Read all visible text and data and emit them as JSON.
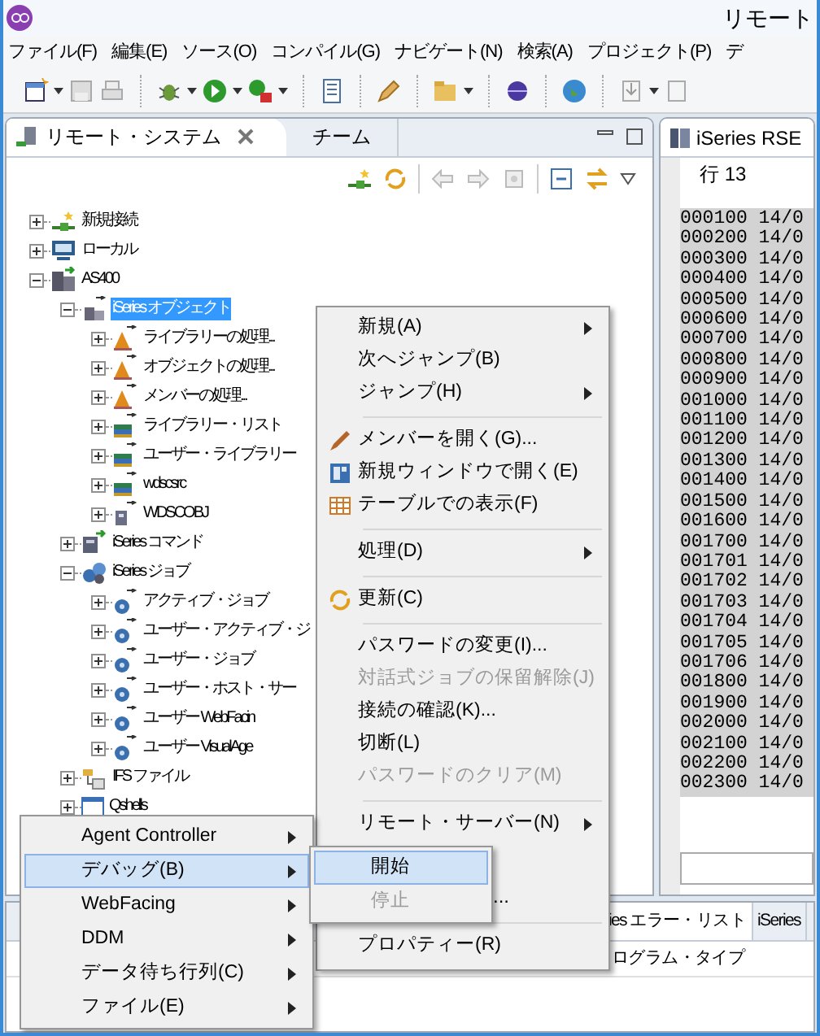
{
  "window": {
    "title": "リモート"
  },
  "menubar": [
    "ファイル(F)",
    "編集(E)",
    "ソース(O)",
    "コンパイル(G)",
    "ナビゲート(N)",
    "検索(A)",
    "プロジェクト(P)",
    "デ"
  ],
  "left_view": {
    "tabs": [
      {
        "label": "リモート・システム",
        "selected": true
      },
      {
        "label": "チーム",
        "selected": false
      }
    ],
    "tree": [
      {
        "label": "新規接続",
        "kind": "connection",
        "expanded": false,
        "selected": false
      },
      {
        "label": "ローカル",
        "kind": "local",
        "expanded": false,
        "selected": false
      },
      {
        "label": "AS400",
        "kind": "system",
        "expanded": true,
        "selected": false,
        "children": [
          {
            "label": "iSeries オブジェクト",
            "kind": "objects",
            "expanded": true,
            "selected": true,
            "children": [
              {
                "label": "ライブラリーの処理...",
                "kind": "work-filter",
                "expanded": false,
                "selected": false
              },
              {
                "label": "オブジェクトの処理...",
                "kind": "work-filter",
                "expanded": false,
                "selected": false
              },
              {
                "label": "メンバーの処理...",
                "kind": "work-filter",
                "expanded": false,
                "selected": false
              },
              {
                "label": "ライブラリー・リスト",
                "kind": "library-filter",
                "expanded": false,
                "selected": false
              },
              {
                "label": "ユーザー・ライブラリー",
                "kind": "library-filter",
                "expanded": false,
                "selected": false
              },
              {
                "label": "wdscsrc",
                "kind": "library-filter",
                "expanded": false,
                "selected": false
              },
              {
                "label": "WDSCOBJ",
                "kind": "object-filter",
                "expanded": false,
                "selected": false
              }
            ]
          },
          {
            "label": "iSeries コマンド",
            "kind": "commands",
            "expanded": false,
            "selected": false
          },
          {
            "label": "iSeries ジョブ",
            "kind": "jobs",
            "expanded": true,
            "selected": false,
            "children": [
              {
                "label": "アクティブ・ジョブ",
                "kind": "job-filter",
                "expanded": false,
                "selected": false
              },
              {
                "label": "ユーザー・アクティブ・ジ",
                "kind": "job-filter",
                "expanded": false,
                "selected": false
              },
              {
                "label": "ユーザー・ジョブ",
                "kind": "job-filter",
                "expanded": false,
                "selected": false
              },
              {
                "label": "ユーザー・ホスト・サー",
                "kind": "job-filter",
                "expanded": false,
                "selected": false
              },
              {
                "label": "ユーザー WebFacin",
                "kind": "job-filter",
                "expanded": false,
                "selected": false
              },
              {
                "label": "ユーザー VisualAge",
                "kind": "job-filter",
                "expanded": false,
                "selected": false
              }
            ]
          },
          {
            "label": "IFS ファイル",
            "kind": "ifs",
            "expanded": false,
            "selected": false
          },
          {
            "label": "Qshells",
            "kind": "shells",
            "expanded": false,
            "selected": false
          }
        ]
      }
    ]
  },
  "editor": {
    "tab": "iSeries RSE",
    "ruler": "行 13",
    "lines": [
      "000100 14/0",
      "000200 14/0",
      "000300 14/0",
      "000400 14/0",
      "000500 14/0",
      "000600 14/0",
      "000700 14/0",
      "000800 14/0",
      "000900 14/0",
      "001000 14/0",
      "001100 14/0",
      "001200 14/0",
      "001300 14/0",
      "001400 14/0",
      "001500 14/0",
      "001600 14/0",
      "001700 14/0",
      "001701 14/0",
      "001702 14/0",
      "001703 14/0",
      "001704 14/0",
      "001705 14/0",
      "001706 14/0",
      "001800 14/0",
      "001900 14/0",
      "002000 14/0",
      "002100 14/0",
      "002200 14/0",
      "002300 14/0"
    ]
  },
  "bottom_panel": {
    "tabs": [
      {
        "label": "ies エラー・リスト",
        "selected": true
      },
      {
        "label": "iSeries",
        "selected": false
      }
    ],
    "columns": [
      "ログラム・タイプ"
    ]
  },
  "context_menu": {
    "items": [
      {
        "kind": "submenu-item",
        "label": "新規(A)",
        "disabled": false,
        "selected": false
      },
      {
        "kind": "item",
        "label": "次へジャンプ(B)",
        "disabled": false,
        "selected": false
      },
      {
        "kind": "submenu-item",
        "label": "ジャンプ(H)",
        "disabled": false,
        "selected": false
      },
      {
        "kind": "separator"
      },
      {
        "kind": "edit-item",
        "label": "メンバーを開く(G)...",
        "disabled": false,
        "selected": false
      },
      {
        "kind": "window-item",
        "label": "新規ウィンドウで開く(E)",
        "disabled": false,
        "selected": false
      },
      {
        "kind": "table-item",
        "label": "テーブルでの表示(F)",
        "disabled": false,
        "selected": false
      },
      {
        "kind": "separator"
      },
      {
        "kind": "submenu-item",
        "label": "処理(D)",
        "disabled": false,
        "selected": false
      },
      {
        "kind": "separator"
      },
      {
        "kind": "refresh-item",
        "label": "更新(C)",
        "disabled": false,
        "selected": false
      },
      {
        "kind": "separator"
      },
      {
        "kind": "item",
        "label": "パスワードの変更(I)...",
        "disabled": false,
        "selected": false
      },
      {
        "kind": "item",
        "label": "対話式ジョブの保留解除(J)",
        "disabled": true,
        "selected": false
      },
      {
        "kind": "item",
        "label": "接続の確認(K)...",
        "disabled": false,
        "selected": false
      },
      {
        "kind": "item",
        "label": "切断(L)",
        "disabled": false,
        "selected": false
      },
      {
        "kind": "item",
        "label": "パスワードのクリア(M)",
        "disabled": true,
        "selected": false
      },
      {
        "kind": "separator"
      },
      {
        "kind": "submenu-item",
        "label": "リモート・サーバー(N)",
        "disabled": false,
        "selected": false
      },
      {
        "kind": "partial",
        "label": "..."
      },
      {
        "kind": "separator"
      },
      {
        "kind": "item",
        "label": "プロパティー(R)",
        "disabled": false,
        "selected": false
      }
    ]
  },
  "cascade_menu": {
    "items": [
      {
        "kind": "submenu-item",
        "label": "Agent Controller",
        "disabled": false,
        "selected": false
      },
      {
        "kind": "submenu-item",
        "label": "デバッグ(B)",
        "disabled": false,
        "selected": true
      },
      {
        "kind": "submenu-item",
        "label": "WebFacing",
        "disabled": false,
        "selected": false
      },
      {
        "kind": "submenu-item",
        "label": "DDM",
        "disabled": false,
        "selected": false
      },
      {
        "kind": "submenu-item",
        "label": "データ待ち行列(C)",
        "disabled": false,
        "selected": false
      },
      {
        "kind": "submenu-item",
        "label": "ファイル(E)",
        "disabled": false,
        "selected": false
      }
    ]
  },
  "debug_submenu": {
    "items": [
      {
        "kind": "item",
        "label": "開始",
        "disabled": false,
        "selected": true
      },
      {
        "kind": "item",
        "label": "停止",
        "disabled": true,
        "selected": false
      }
    ]
  }
}
